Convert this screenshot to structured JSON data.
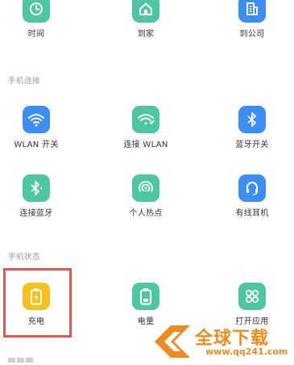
{
  "colors": {
    "teal": "#4fc6a2",
    "blue": "#3d8ef3",
    "yellow": "#f6c21b",
    "highlight": "#e25551",
    "watermark": "#ef8b1e"
  },
  "sections": {
    "phone_connection": "手机连接",
    "phone_status": "手机状态"
  },
  "row1": [
    {
      "label": "时间",
      "icon": "clock-icon"
    },
    {
      "label": "到家",
      "icon": "home-icon"
    },
    {
      "label": "到公司",
      "icon": "office-building-icon"
    }
  ],
  "row2": [
    {
      "label": "WLAN 开关",
      "icon": "wifi-icon"
    },
    {
      "label": "连接 WLAN",
      "icon": "wifi-connect-icon"
    },
    {
      "label": "蓝牙开关",
      "icon": "bluetooth-icon"
    }
  ],
  "row3": [
    {
      "label": "连接蓝牙",
      "icon": "bluetooth-connect-icon"
    },
    {
      "label": "个人热点",
      "icon": "hotspot-icon"
    },
    {
      "label": "有线耳机",
      "icon": "headset-icon"
    }
  ],
  "row4": [
    {
      "label": "充电",
      "icon": "charging-battery-icon"
    },
    {
      "label": "电量",
      "icon": "battery-level-icon"
    },
    {
      "label": "打开应用",
      "icon": "apps-grid-icon"
    }
  ],
  "watermark": {
    "title": "全球下载",
    "url": "www.qq241.com"
  }
}
